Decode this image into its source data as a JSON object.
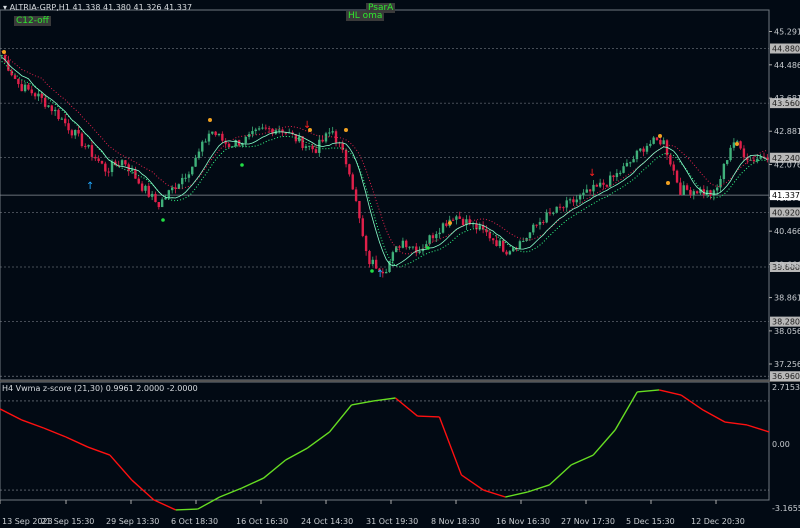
{
  "header": {
    "symbol": "ALTRIA-GRP,H1",
    "ohlc": "41.338 41.380 41.326 41.337"
  },
  "tags": {
    "c12": "C12-off",
    "psar": "PsarA",
    "hloma": "HL oma"
  },
  "subwindow": {
    "title": "H4 Vwma z-score (21,30) 0.9961 2.0000 -2.0000"
  },
  "colors": {
    "bg": "#020a14",
    "bull": "#3fb07a",
    "bear": "#e0204a",
    "osc_up": "#66dd22",
    "osc_down": "#ff1010",
    "up_arrow": "#22aaff",
    "down_arrow": "#ff2020"
  },
  "chart_data": [
    {
      "type": "candlestick",
      "ylim": [
        36.96,
        45.4
      ],
      "price_ticks": [
        "45.291",
        "44.486",
        "43.681",
        "42.881",
        "42.076",
        "41.271",
        "40.466",
        "39.666",
        "38.861",
        "38.056",
        "37.256"
      ],
      "price_levels": [
        "44.880",
        "43.560",
        "42.240",
        "40.920",
        "39.600",
        "38.280",
        "36.960"
      ],
      "current_price": "41.337",
      "x_ticks": [
        "13 Sep 2023",
        "21 Sep 15:30",
        "29 Sep 13:30",
        "6 Oct 18:30",
        "16 Oct 16:30",
        "24 Oct 14:30",
        "31 Oct 19:30",
        "8 Nov 18:30",
        "16 Nov 16:30",
        "27 Nov 17:30",
        "5 Dec 15:30",
        "12 Dec 20:30"
      ],
      "close_path": [
        44.72,
        43.99,
        43.76,
        43.39,
        42.91,
        42.43,
        41.94,
        42.19,
        41.58,
        41.1,
        41.58,
        42.07,
        42.91,
        42.55,
        42.67,
        42.91,
        42.96,
        42.67,
        42.43,
        42.91,
        41.94,
        39.77,
        39.53,
        40.25,
        40.01,
        40.49,
        40.86,
        40.62,
        40.37,
        40.01,
        40.25,
        40.74,
        40.98,
        41.22,
        41.46,
        41.7,
        42.07,
        42.55,
        42.67,
        41.46,
        41.46,
        41.34,
        42.67,
        42.19,
        42.31
      ]
    },
    {
      "type": "line",
      "title": "H4 Vwma z-score (21,30)",
      "ylim": [
        -3.1655,
        2.7153
      ],
      "y_ticks": [
        "2.7153",
        "0.00",
        "-3.1655"
      ],
      "levels": [
        2.0,
        -2.0
      ],
      "values": [
        1.64,
        1.14,
        0.78,
        0.38,
        -0.07,
        -0.43,
        -1.55,
        -2.44,
        -2.89,
        -2.85,
        -2.31,
        -1.91,
        -1.46,
        -0.65,
        -0.11,
        0.61,
        1.82,
        2.0,
        2.13,
        1.32,
        1.28,
        -1.32,
        -2.0,
        -2.31,
        -2.09,
        -1.77,
        -0.87,
        -0.43,
        0.7,
        2.4,
        2.49,
        2.26,
        1.59,
        1.05,
        0.92,
        0.61
      ]
    }
  ]
}
